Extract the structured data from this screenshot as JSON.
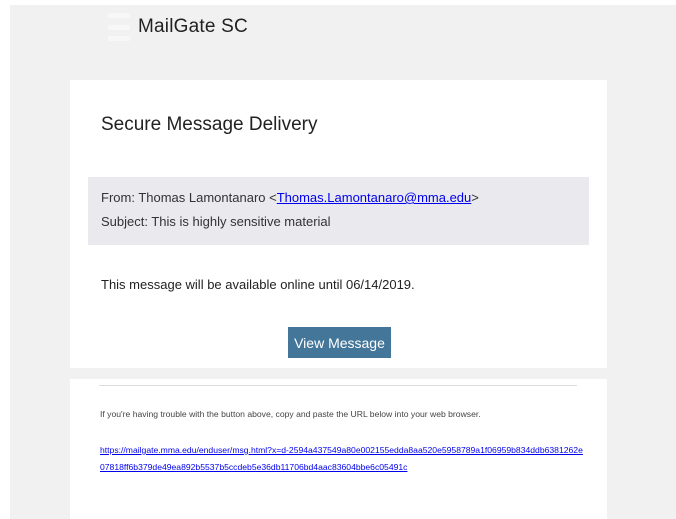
{
  "brand": {
    "name": "MailGate SC"
  },
  "message": {
    "title": "Secure Message Delivery",
    "from_prefix": "From: Thomas Lamontanaro <",
    "from_email": "Thomas.Lamontanaro@mma.edu",
    "from_suffix": ">",
    "subject": "Subject: This is highly sensitive material",
    "availability": "This message will be available online until 06/14/2019.",
    "button_label": "View Message"
  },
  "footer": {
    "help_text": "If you're having trouble with the button above, copy and paste the URL below into your web browser.",
    "url": "https://mailgate.mma.edu/enduser/msg.html?x=d-2594a437549a80e002155edda8aa520e5958789a1f06959b834ddb6381262e07818ff6b379de49ea892b5537b5ccdeb5e36db11706bd4aac83604bbe6c05491c"
  },
  "colors": {
    "page_background": "#f1f1f1",
    "card_background": "#ffffff",
    "meta_background": "#e9e9ee",
    "button_background": "#44769a",
    "link": "#0000ee"
  }
}
